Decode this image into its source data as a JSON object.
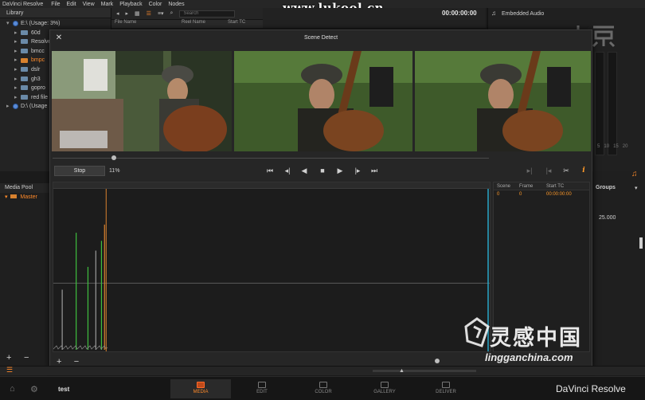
{
  "menubar": {
    "app_name": "DaVinci Resolve",
    "items": [
      "File",
      "Edit",
      "View",
      "Mark",
      "Playback",
      "Color",
      "Nodes"
    ]
  },
  "watermark_top": "www.lukool.cn",
  "library": {
    "title": "Library",
    "items": [
      {
        "label": "E:\\ (Usage: 3%)",
        "level": 0,
        "kind": "disk",
        "expanded": true
      },
      {
        "label": "60d",
        "level": 1,
        "kind": "folder"
      },
      {
        "label": "Resolve",
        "level": 1,
        "kind": "folder"
      },
      {
        "label": "bmcc",
        "level": 1,
        "kind": "folder"
      },
      {
        "label": "bmpc",
        "level": 1,
        "kind": "folder",
        "selected": true
      },
      {
        "label": "dslr",
        "level": 1,
        "kind": "folder"
      },
      {
        "label": "gh3",
        "level": 1,
        "kind": "folder"
      },
      {
        "label": "gopro",
        "level": 1,
        "kind": "folder"
      },
      {
        "label": "red file",
        "level": 1,
        "kind": "folder"
      },
      {
        "label": "D:\\ (Usage",
        "level": 0,
        "kind": "disk"
      }
    ]
  },
  "browser": {
    "search_placeholder": "Search",
    "columns": [
      "File Name",
      "Reel Name",
      "Start TC"
    ]
  },
  "viewer": {
    "timecode": "00:00:00:00"
  },
  "audio": {
    "title": "Embedded Audio",
    "meter_labels": [
      "5",
      "10",
      "15",
      "20"
    ]
  },
  "scene_detect": {
    "title": "Scene Detect",
    "stop_label": "Stop",
    "progress": "11%",
    "progress_value": 0.11,
    "scene_list": {
      "columns": [
        "Scene",
        "Frame",
        "Start TC"
      ],
      "rows": [
        {
          "scene": "0",
          "frame": "0",
          "start_tc": "00:00:00:00"
        }
      ]
    },
    "graph_spikes": [
      {
        "pos": 0.013,
        "height": 0.38,
        "color": "#9a9a9a"
      },
      {
        "pos": 0.045,
        "height": 0.73,
        "color": "#3fbf3f"
      },
      {
        "pos": 0.072,
        "height": 0.52,
        "color": "#3fbf3f"
      },
      {
        "pos": 0.09,
        "height": 0.62,
        "color": "#9a9a9a"
      },
      {
        "pos": 0.103,
        "height": 0.68,
        "color": "#3fbf3f"
      },
      {
        "pos": 0.11,
        "height": 0.78,
        "color": "#d7812e"
      }
    ],
    "graph_threshold": 0.42
  },
  "media_pool": {
    "title": "Media Pool",
    "master_label": "Master"
  },
  "groups": {
    "title": "Groups",
    "value": "25.000"
  },
  "bottom": {
    "project_name": "test",
    "tabs": [
      {
        "label": "MEDIA",
        "active": true
      },
      {
        "label": "EDIT",
        "active": false
      },
      {
        "label": "COLOR",
        "active": false
      },
      {
        "label": "GALLERY",
        "active": false
      },
      {
        "label": "DELIVER",
        "active": false
      }
    ],
    "brand": "DaVinci Resolve"
  },
  "watermark_bottom": {
    "text": "灵感中国",
    "url": "lingganchina.com"
  },
  "colors": {
    "accent": "#ff8a2a",
    "panel": "#262626",
    "background": "#1b1b1b"
  }
}
